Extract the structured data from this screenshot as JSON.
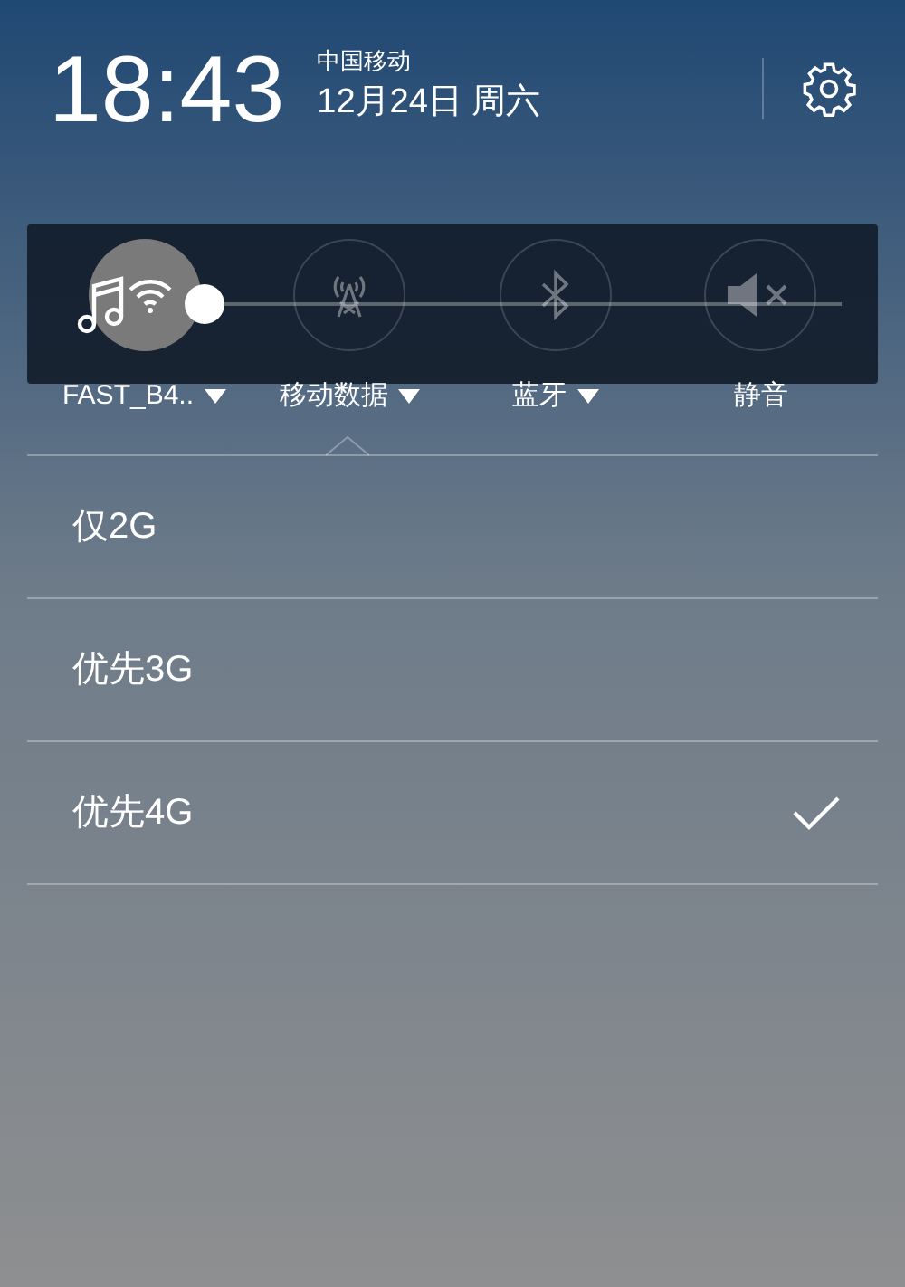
{
  "header": {
    "time": "18:43",
    "carrier": "中国移动",
    "date": "12月24日 周六"
  },
  "toggles": [
    {
      "kind": "wifi",
      "label": "FAST_B4..",
      "on": true,
      "dropdown": true
    },
    {
      "kind": "mobile-data",
      "label": "移动数据",
      "on": false,
      "dropdown": true
    },
    {
      "kind": "bluetooth",
      "label": "蓝牙",
      "on": false,
      "dropdown": true
    },
    {
      "kind": "mute",
      "label": "静音",
      "on": false,
      "dropdown": false
    }
  ],
  "volume": {
    "level": 0
  },
  "network_options": [
    {
      "label": "仅2G",
      "selected": false
    },
    {
      "label": "优先3G",
      "selected": false
    },
    {
      "label": "优先4G",
      "selected": true
    }
  ]
}
